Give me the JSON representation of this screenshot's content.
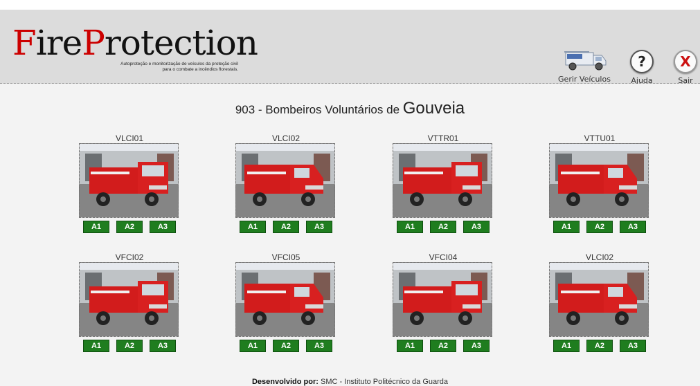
{
  "header": {
    "logo_part1": "Fire",
    "logo_part2": "Protection",
    "logo_subtitle_line1": "Autoproteção e monitorização de veículos da proteção civil",
    "logo_subtitle_line2": "para o combate a incêndios florestais.",
    "nav": {
      "manage_label": "Gerir Veículos",
      "help_label": "Ajuda",
      "help_symbol": "?",
      "exit_label": "Sair",
      "exit_symbol": "X"
    }
  },
  "main": {
    "title_prefix": "903 - Bombeiros Voluntários de",
    "title_city": "Gouveia",
    "vehicles": [
      {
        "name": "VLCI01",
        "buttons": [
          "A1",
          "A2",
          "A3"
        ]
      },
      {
        "name": "VLCI02",
        "buttons": [
          "A1",
          "A2",
          "A3"
        ]
      },
      {
        "name": "VTTR01",
        "buttons": [
          "A1",
          "A2",
          "A3"
        ]
      },
      {
        "name": "VTTU01",
        "buttons": [
          "A1",
          "A2",
          "A3"
        ]
      },
      {
        "name": "VFCI02",
        "buttons": [
          "A1",
          "A2",
          "A3"
        ]
      },
      {
        "name": "VFCI05",
        "buttons": [
          "A1",
          "A2",
          "A3"
        ]
      },
      {
        "name": "VFCI04",
        "buttons": [
          "A1",
          "A2",
          "A3"
        ]
      },
      {
        "name": "VLCI02",
        "buttons": [
          "A1",
          "A2",
          "A3"
        ]
      }
    ]
  },
  "footer": {
    "label": "Desenvolvido por:",
    "text": "SMC - Instituto Politécnico da Guarda"
  },
  "colors": {
    "header_bg": "#dcdcdc",
    "content_bg": "#f3f3f3",
    "logo_red": "#cc0000",
    "button_green": "#1f7d1f",
    "truck_red": "#d21c1c"
  },
  "icons": {
    "manage": "fire-truck-icon",
    "help": "question-icon",
    "exit": "close-icon"
  }
}
